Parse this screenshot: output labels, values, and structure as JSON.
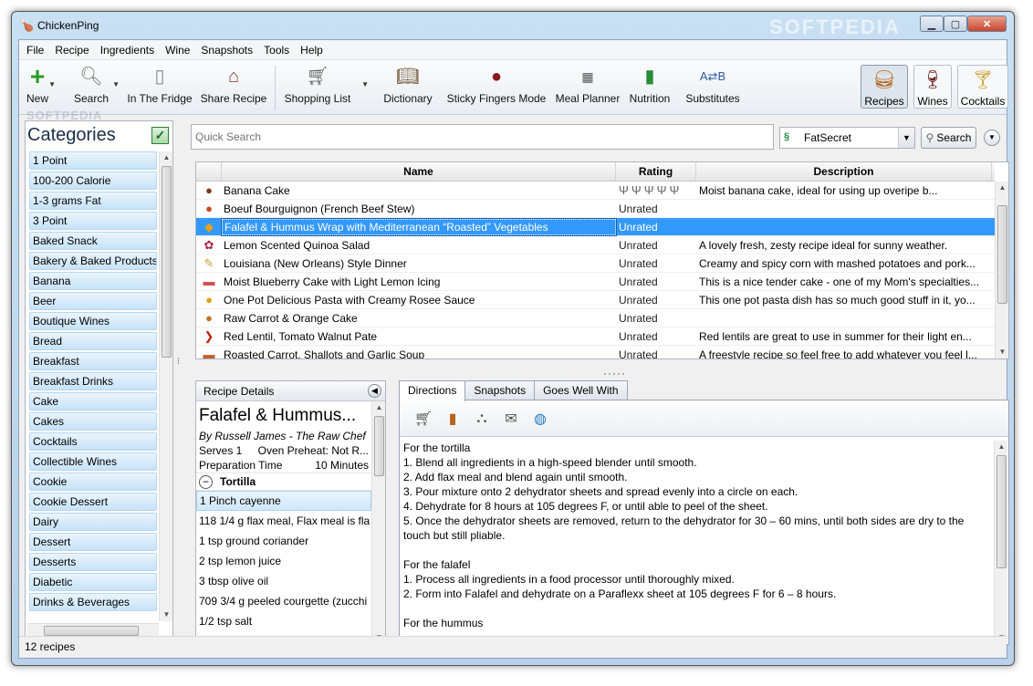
{
  "window": {
    "title": "ChickenPing",
    "watermark": "SOFTPEDIA"
  },
  "menu": [
    "File",
    "Recipe",
    "Ingredients",
    "Wine",
    "Snapshots",
    "Tools",
    "Help"
  ],
  "toolbar": {
    "new": "New",
    "search": "Search",
    "fridge": "In The Fridge",
    "share": "Share Recipe",
    "shopping": "Shopping List",
    "dictionary": "Dictionary",
    "sticky": "Sticky Fingers Mode",
    "planner": "Meal Planner",
    "nutrition": "Nutrition",
    "substitutes": "Substitutes",
    "recipes": "Recipes",
    "wines": "Wines",
    "cocktails": "Cocktails"
  },
  "categories": {
    "title": "Categories",
    "items": [
      "1 Point",
      "100-200 Calorie",
      "1-3 grams Fat",
      "3 Point",
      "Baked Snack",
      "Bakery & Baked Products",
      "Banana",
      "Beer",
      "Boutique Wines",
      "Bread",
      "Breakfast",
      "Breakfast Drinks",
      "Cake",
      "Cakes",
      "Cocktails",
      "Collectible Wines",
      "Cookie",
      "Cookie Dessert",
      "Dairy",
      "Dessert",
      "Desserts",
      "Diabetic",
      "Drinks & Beverages"
    ]
  },
  "search": {
    "placeholder": "Quick Search",
    "provider": "FatSecret",
    "button": "Search"
  },
  "grid": {
    "headers": {
      "name": "Name",
      "rating": "Rating",
      "description": "Description"
    },
    "rows": [
      {
        "name": "Banana Cake",
        "rating": "",
        "description": "Moist banana cake, ideal for using up overipe b..."
      },
      {
        "name": "Boeuf Bourguignon (French Beef Stew)",
        "rating": "Unrated",
        "description": ""
      },
      {
        "name": "Falafel & Hummus Wrap with Mediterranean “Roasted” Vegetables",
        "rating": "Unrated",
        "description": ""
      },
      {
        "name": "Lemon Scented Quinoa Salad",
        "rating": "Unrated",
        "description": "A lovely fresh, zesty recipe ideal for sunny weather."
      },
      {
        "name": "Louisiana (New Orleans) Style Dinner",
        "rating": "Unrated",
        "description": "Creamy and spicy corn with mashed potatoes and pork..."
      },
      {
        "name": "Moist Blueberry Cake with Light Lemon Icing",
        "rating": "Unrated",
        "description": "This is a nice tender cake - one of my Mom's specialties..."
      },
      {
        "name": "One Pot Delicious Pasta with Creamy Rosee Sauce",
        "rating": "Unrated",
        "description": "This one pot pasta dish has so much good stuff in it, yo..."
      },
      {
        "name": "Raw Carrot & Orange Cake",
        "rating": "Unrated",
        "description": ""
      },
      {
        "name": "Red Lentil, Tomato Walnut Pate",
        "rating": "Unrated",
        "description": "Red lentils are great to use in summer for their light en..."
      },
      {
        "name": "Roasted Carrot, Shallots and Garlic Soup",
        "rating": "Unrated",
        "description": "A freestyle recipe so feel free to add whatever you feel l..."
      }
    ]
  },
  "details": {
    "header": "Recipe Details",
    "title": "Falafel & Hummus...",
    "author": "By Russell James - The Raw Chef",
    "serves": "Serves 1",
    "preheat": "Oven Preheat: Not R...",
    "prep_label": "Preparation Time",
    "prep_value": "10 Minutes",
    "section": "Tortilla",
    "ingredients": [
      "1 Pinch cayenne",
      "118 1/4 g flax meal, Flax meal is fla",
      "1 tsp ground coriander",
      "2 tsp lemon juice",
      "3 tbsp olive oil",
      "709 3/4 g peeled courgette (zucchi",
      "1/2 tsp salt"
    ]
  },
  "tabs": [
    "Directions",
    "Snapshots",
    "Goes Well With"
  ],
  "directions": "For the tortilla\n1. Blend all ingredients in a high-speed blender until smooth.\n2. Add flax meal and blend again until smooth.\n3. Pour mixture onto 2 dehydrator sheets and spread evenly into a circle on each.\n4. Dehydrate for 8 hours at 105 degrees F, or until able to peel of the sheet.\n5. Once the dehydrator sheets are removed, return to the dehydrator for 30 – 60 mins, until both sides are dry to the\ntouch but still pliable.\n\nFor the falafel\n1. Process all ingredients in a food processor until thoroughly mixed.\n2. Form into Falafel and dehydrate on a Paraflexx sheet at 105 degrees F for 6 – 8 hours.\n\nFor the hummus\nBlend all ingredients in a high-power blender until smooth.",
  "status": "12 recipes"
}
